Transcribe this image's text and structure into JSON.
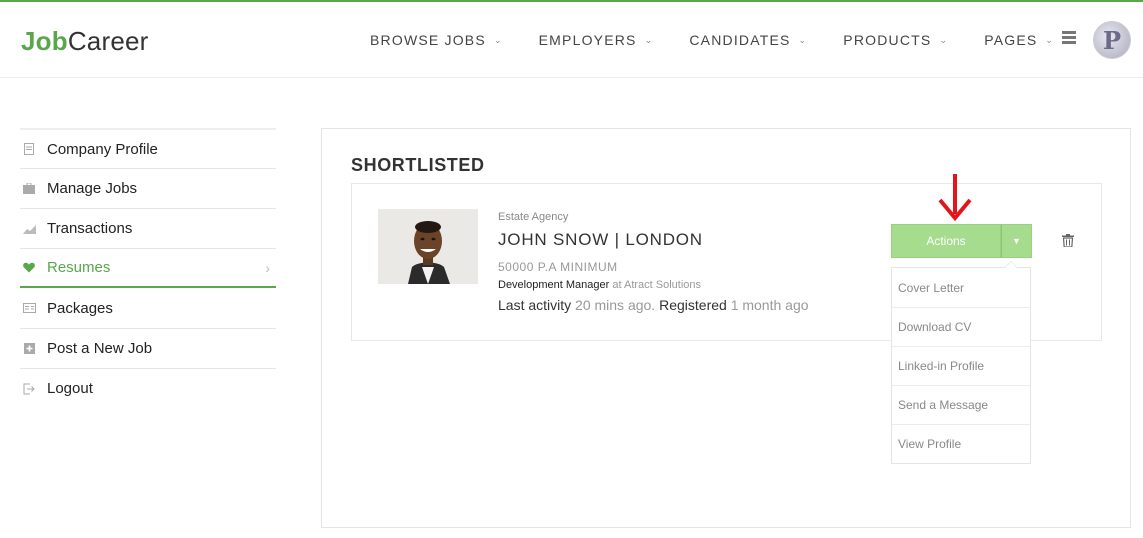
{
  "colors": {
    "accent": "#5aa64a",
    "button": "#a5dc8e",
    "arrow": "#e3141c"
  },
  "header": {
    "logo_part1": "Job",
    "logo_part2": "Career",
    "nav": [
      {
        "label": "BROWSE JOBS"
      },
      {
        "label": "EMPLOYERS"
      },
      {
        "label": "CANDIDATES"
      },
      {
        "label": "PRODUCTS"
      },
      {
        "label": "PAGES"
      }
    ],
    "avatar_letter": "P"
  },
  "sidebar": {
    "items": [
      {
        "label": "Company Profile",
        "icon": "document-icon"
      },
      {
        "label": "Manage Jobs",
        "icon": "briefcase-icon"
      },
      {
        "label": "Transactions",
        "icon": "chart-icon"
      },
      {
        "label": "Resumes",
        "icon": "heart-icon",
        "active": true
      },
      {
        "label": "Packages",
        "icon": "card-icon"
      },
      {
        "label": "Post a New Job",
        "icon": "plus-icon"
      },
      {
        "label": "Logout",
        "icon": "logout-icon"
      }
    ]
  },
  "main": {
    "title": "SHORTLISTED",
    "candidate": {
      "company": "Estate Agency",
      "name": "JOHN SNOW | LONDON",
      "salary": "50000 P.A MINIMUM",
      "position": "Development Manager",
      "position_at": "at Atract Solutions",
      "activity_label": "Last activity",
      "activity_value": "20 mins ago.",
      "registered_label": "Registered",
      "registered_value": "1 month ago"
    },
    "actions_label": "Actions",
    "dropdown": [
      "Cover Letter",
      "Download CV",
      "Linked-in Profile",
      "Send a Message",
      "View Profile"
    ]
  }
}
